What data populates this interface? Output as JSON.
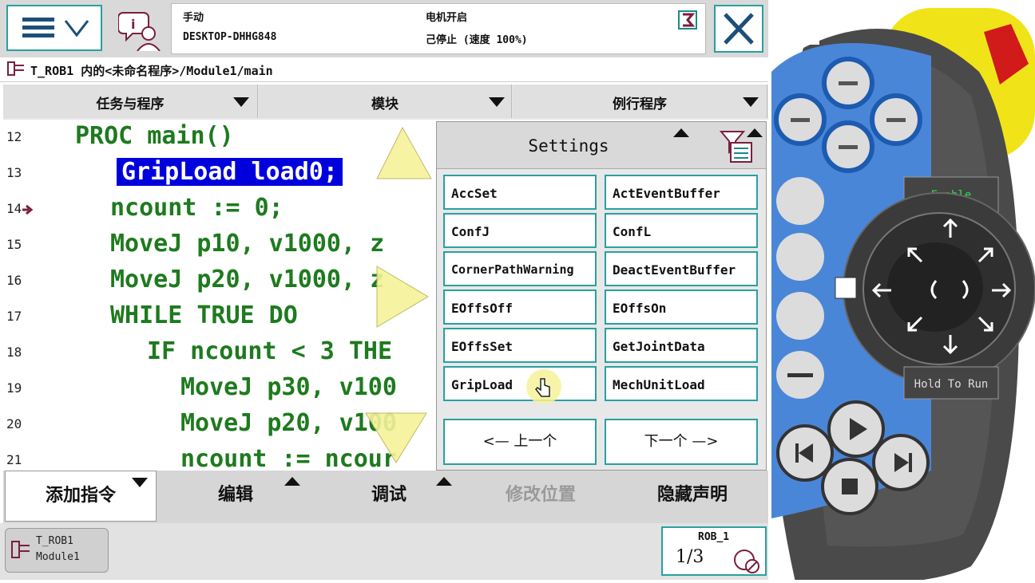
{
  "status": {
    "mode": "手动",
    "system_name": "DESKTOP-DHHG848",
    "motor_state": "电机开启",
    "program_state": "己停止 (速度 100%)"
  },
  "path": "T_ROB1 内的<未命名程序>/Module1/main",
  "nav": {
    "tasks": "任务与程序",
    "modules": "模块",
    "routines": "例行程序"
  },
  "code": {
    "line_numbers": [
      "12",
      "13",
      "14",
      "15",
      "16",
      "17",
      "18",
      "19",
      "20",
      "21"
    ],
    "lines": [
      "PROC main()",
      "GripLoad load0;",
      "ncount := 0;",
      "MoveJ p10, v1000, z",
      "MoveJ p20, v1000, z",
      "WHILE TRUE DO",
      "IF ncount < 3 THE",
      "MoveJ p30, v100",
      "MoveJ p20, v100",
      "ncount := ncour"
    ]
  },
  "settings": {
    "title": "Settings",
    "items": [
      "AccSet",
      "ActEventBuffer",
      "ConfJ",
      "ConfL",
      "CornerPathWarning",
      "DeactEventBuffer",
      "EOffsOff",
      "EOffsOn",
      "EOffsSet",
      "GetJointData",
      "GripLoad",
      "MechUnitLoad"
    ],
    "prev": "<—  上一个",
    "next": "下一个  —>"
  },
  "bottom": {
    "add_instruction": "添加指令",
    "edit": "编辑",
    "debug": "调试",
    "modify_position": "修改位置",
    "hide_declarations": "隐藏声明"
  },
  "taskbar": {
    "task_line1": "T_ROB1",
    "task_line2": "Module1",
    "rob_label": "ROB_1",
    "rob_fraction": "1/3"
  },
  "pendant": {
    "enable": "Enable",
    "hold_to_run": "Hold To Run"
  },
  "colors": {
    "accent": "#2aa0a0",
    "code_green": "#1e7a1e",
    "highlight": "#0000dd",
    "pendant_blue": "#4a86d8"
  }
}
